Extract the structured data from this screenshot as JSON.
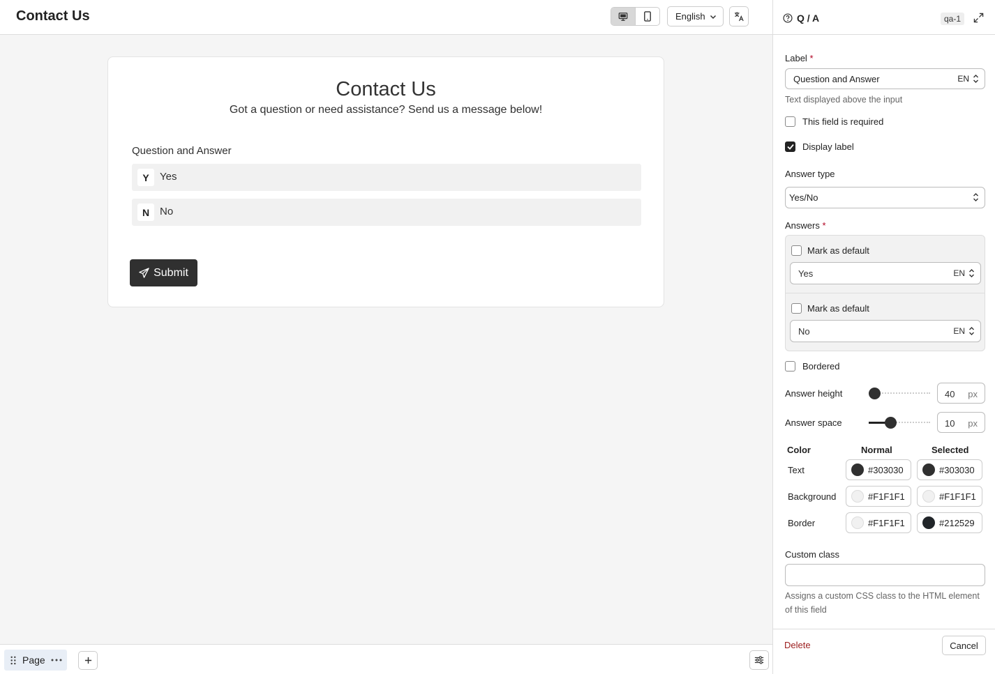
{
  "header": {
    "title": "Contact Us",
    "language": "English"
  },
  "form": {
    "title": "Contact Us",
    "subtitle": "Got a question or need assistance? Send us a message below!",
    "question_label": "Question and Answer",
    "answers": [
      {
        "key": "Y",
        "text": "Yes"
      },
      {
        "key": "N",
        "text": "No"
      }
    ],
    "submit_label": "Submit"
  },
  "footer": {
    "page_label": "Page"
  },
  "panel": {
    "title": "Q / A",
    "badge": "qa-1",
    "label_field": {
      "label": "Label",
      "value": "Question and Answer",
      "lang": "EN",
      "hint": "Text displayed above the input"
    },
    "required": {
      "label": "This field is required",
      "checked": false
    },
    "display_label": {
      "label": "Display label",
      "checked": true
    },
    "answer_type": {
      "label": "Answer type",
      "value": "Yes/No"
    },
    "answers": {
      "label": "Answers",
      "items": [
        {
          "default_label": "Mark as default",
          "value": "Yes",
          "lang": "EN"
        },
        {
          "default_label": "Mark as default",
          "value": "No",
          "lang": "EN"
        }
      ]
    },
    "bordered": {
      "label": "Bordered",
      "checked": false
    },
    "answer_height": {
      "label": "Answer height",
      "value": "40",
      "unit": "px"
    },
    "answer_space": {
      "label": "Answer space",
      "value": "10",
      "unit": "px"
    },
    "colors": {
      "header": {
        "color": "Color",
        "normal": "Normal",
        "selected": "Selected"
      },
      "rows": [
        {
          "label": "Text",
          "normal": "#303030",
          "selected": "#303030"
        },
        {
          "label": "Background",
          "normal": "#F1F1F1",
          "selected": "#F1F1F1"
        },
        {
          "label": "Border",
          "normal": "#F1F1F1",
          "selected": "#212529"
        }
      ]
    },
    "custom_class": {
      "label": "Custom class",
      "value": "",
      "hint": "Assigns a custom CSS class to the HTML element of this field"
    },
    "delete_label": "Delete",
    "cancel_label": "Cancel"
  }
}
